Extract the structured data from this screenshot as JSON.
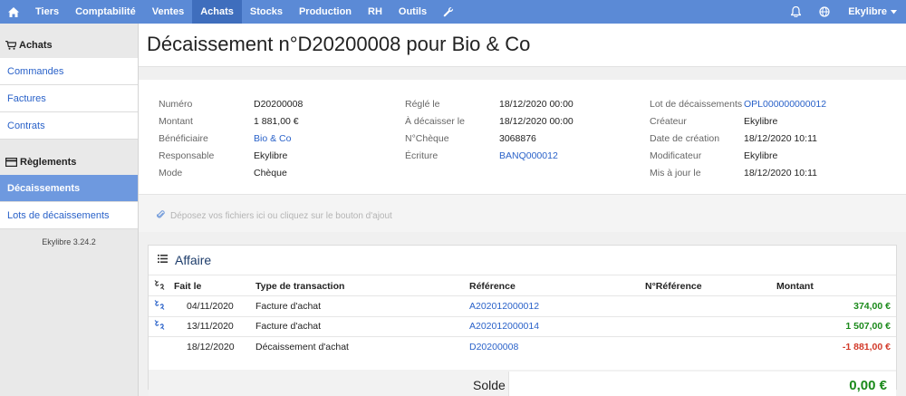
{
  "nav": {
    "home_icon": "home-icon",
    "items": [
      "Tiers",
      "Comptabilité",
      "Ventes",
      "Achats",
      "Stocks",
      "Production",
      "RH",
      "Outils"
    ],
    "active": "Achats",
    "tools_icon": "wrench-icon",
    "bell_icon": "bell-icon",
    "globe_icon": "globe-icon",
    "user": "Ekylibre"
  },
  "sidebar": {
    "section1": {
      "title": "Achats",
      "icon": "cart-icon",
      "links": [
        "Commandes",
        "Factures",
        "Contrats"
      ]
    },
    "section2": {
      "title": "Règlements",
      "icon": "card-icon",
      "links": [
        "Décaissements",
        "Lots de décaissements"
      ],
      "active": "Décaissements"
    },
    "version": "Ekylibre 3.24.2"
  },
  "page": {
    "title": "Décaissement n°D20200008 pour Bio & Co"
  },
  "info": {
    "col1": [
      {
        "label": "Numéro",
        "value": "D20200008"
      },
      {
        "label": "Montant",
        "value": "1 881,00 €"
      },
      {
        "label": "Bénéficiaire",
        "value": "Bio & Co",
        "link": true
      },
      {
        "label": "Responsable",
        "value": "Ekylibre"
      },
      {
        "label": "Mode",
        "value": "Chèque"
      }
    ],
    "col2": [
      {
        "label": "Réglé le",
        "value": "18/12/2020 00:00"
      },
      {
        "label": "À décaisser le",
        "value": "18/12/2020 00:00"
      },
      {
        "label": "N°Chèque",
        "value": "3068876"
      },
      {
        "label": "Écriture",
        "value": "BANQ000012",
        "link": true
      }
    ],
    "col3": [
      {
        "label": "Lot de décaissements",
        "value": "OPL000000000012",
        "link": true
      },
      {
        "label": "Créateur",
        "value": "Ekylibre"
      },
      {
        "label": "Date de création",
        "value": "18/12/2020 10:11"
      },
      {
        "label": "Modificateur",
        "value": "Ekylibre"
      },
      {
        "label": "Mis à jour le",
        "value": "18/12/2020 10:11"
      }
    ]
  },
  "dropzone": {
    "icon": "paperclip-icon",
    "text": "Déposez vos fichiers ici ou cliquez sur le bouton d'ajout"
  },
  "affaire": {
    "title": "Affaire",
    "icon": "list-icon",
    "headers": {
      "fait_le": "Fait le",
      "type": "Type de transaction",
      "reference": "Référence",
      "n_reference": "N°Référence",
      "montant": "Montant"
    },
    "rows": [
      {
        "unlink": true,
        "date": "04/11/2020",
        "type": "Facture d'achat",
        "reference": "A202012000012",
        "n_reference": "",
        "montant": "374,00 €",
        "sign": "pos"
      },
      {
        "unlink": true,
        "date": "13/11/2020",
        "type": "Facture d'achat",
        "reference": "A202012000014",
        "n_reference": "",
        "montant": "1 507,00 €",
        "sign": "pos"
      },
      {
        "unlink": false,
        "date": "18/12/2020",
        "type": "Décaissement d'achat",
        "reference": "D20200008",
        "n_reference": "",
        "montant": "-1 881,00 €",
        "sign": "neg"
      }
    ],
    "solde_label": "Solde",
    "solde_value": "0,00 €"
  },
  "colors": {
    "nav": "#5b8ad6",
    "nav_active": "#3f6ebd",
    "link": "#2a62c9",
    "positive": "#1b8a1b",
    "negative": "#d23a2a"
  }
}
